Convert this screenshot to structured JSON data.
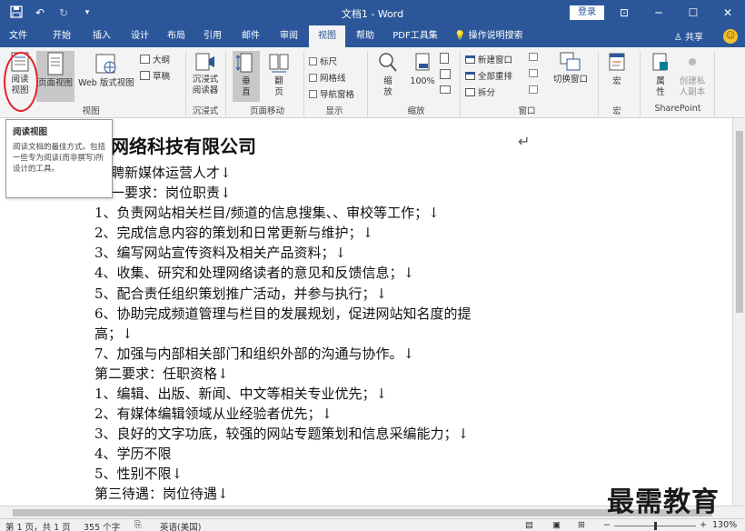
{
  "titlebar": {
    "title": "文档1  -  Word",
    "login_label": "登录",
    "qat": [
      "save-icon",
      "undo-icon",
      "redo-icon",
      "customize-icon"
    ]
  },
  "tabs": [
    {
      "label": "文件"
    },
    {
      "label": "开始"
    },
    {
      "label": "插入"
    },
    {
      "label": "设计"
    },
    {
      "label": "布局"
    },
    {
      "label": "引用"
    },
    {
      "label": "邮件"
    },
    {
      "label": "审阅"
    },
    {
      "label": "视图"
    },
    {
      "label": "帮助"
    },
    {
      "label": "PDF工具集"
    },
    {
      "label": "操作说明搜索"
    }
  ],
  "share_label": "共享",
  "ribbon": {
    "views": {
      "read_mode": "阅读\n视图",
      "print_layout": "页面视图",
      "web_layout": "Web 版式视图",
      "outline": "大纲",
      "draft": "草稿",
      "group_label": "视图"
    },
    "immersive": {
      "reader": "沉浸式\n阅读器",
      "group_label": "沉浸式"
    },
    "page_movement": {
      "vertical": "垂\n直",
      "side_to_side": "翻\n页",
      "group_label": "页面移动"
    },
    "show": {
      "ruler": "标尺",
      "gridlines": "网格线",
      "nav_pane": "导航窗格",
      "group_label": "显示"
    },
    "zoom": {
      "zoom": "缩\n放",
      "percent": "100%",
      "group_label": "缩放"
    },
    "window": {
      "new_window": "新建窗口",
      "arrange_all": "全部重排",
      "split": "拆分",
      "switch": "切换窗口",
      "group_label": "窗口"
    },
    "macros": {
      "macros": "宏",
      "group_label": "宏"
    },
    "sharepoint": {
      "properties": "属\n性",
      "private_copy": "创建私\n人副本",
      "group_label": "SharePoint"
    }
  },
  "tooltip": {
    "title": "阅读视图",
    "body": "阅读文档的最佳方式。包括一些专为阅读(而非撰写)所设计的工具。"
  },
  "document": {
    "title": "网络科技有限公司",
    "lines": [
      "聘新媒体运营人才↓",
      "一要求：岗位职责↓",
      "1、负责网站相关栏目/频道的信息搜集、、审校等工作；↓",
      "2、完成信息内容的策划和日常更新与维护；↓",
      "3、编写网站宣传资料及相关产品资料；↓",
      "4、收集、研究和处理网络读者的意见和反馈信息；↓",
      "5、配合责任组织策划推广活动，并参与执行；↓",
      "6、协助完成频道管理与栏目的发展规划，促进网站知名度的提",
      "高；↓",
      "7、加强与内部相关部门和组织外部的沟通与协作。↓",
      "第二要求：任职资格↓",
      "1、编辑、出版、新闻、中文等相关专业优先；↓",
      "2、有媒体编辑领域从业经验者优先；↓",
      "3、良好的文字功底，较强的网站专题策划和信息采编能力；↓",
      "4、学历不限",
      "5、性别不限↓",
      "第三待遇：岗位待遇↓"
    ]
  },
  "watermark": "最需教育",
  "statusbar": {
    "page": "第 1 页，共 1 页",
    "words": "355 个字",
    "language": "英语(美国)",
    "zoom": "130%"
  }
}
